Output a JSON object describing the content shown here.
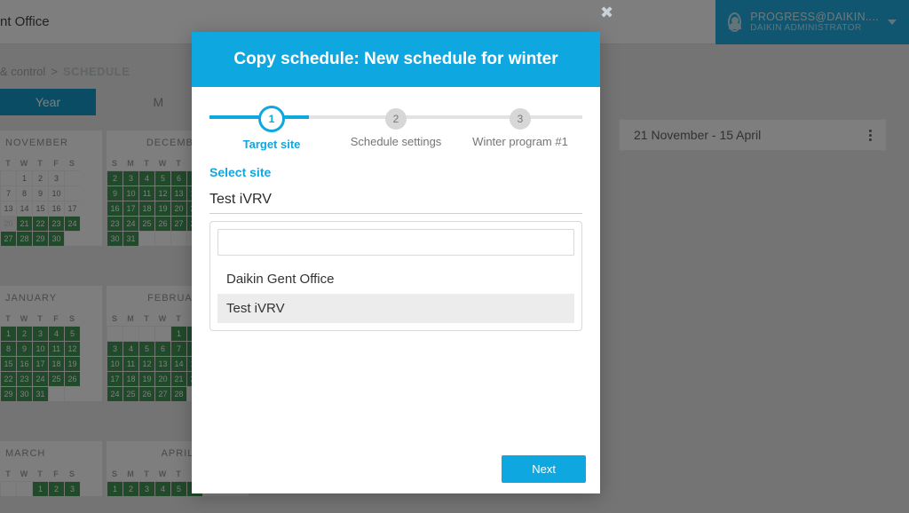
{
  "header": {
    "site_fragment": "nt Office",
    "user_line1": "PROGRESS@DAIKIN....",
    "user_line2": "DAIKIN ADMINISTRATOR"
  },
  "breadcrumb": {
    "a": "& control",
    "sep": ">",
    "b": "SCHEDULE"
  },
  "tabs": {
    "year": "Year",
    "m": "M"
  },
  "schedule_card": {
    "range": "21 November - 15 April"
  },
  "months": {
    "nov": "NOVEMBER",
    "dec": "DECEMBER",
    "jan": "JANUARY",
    "feb": "FEBRUARY",
    "mar": "MARCH",
    "apr": "APRIL"
  },
  "dow": [
    "T",
    "W",
    "T",
    "F",
    "S",
    "S",
    "M",
    "T",
    "W",
    "T",
    "F",
    "S"
  ],
  "modal": {
    "title": "Copy schedule: New schedule for winter",
    "step_nums": {
      "s1": "1",
      "s2": "2",
      "s3": "3"
    },
    "steps": {
      "s1": "Target site",
      "s2": "Schedule settings",
      "s3": "Winter program #1"
    },
    "select_site_label": "Select site",
    "site_value": "Test iVRV",
    "search_placeholder": "",
    "options": {
      "o1": "Daikin Gent Office",
      "o2": "Test iVRV"
    },
    "next": "Next"
  }
}
